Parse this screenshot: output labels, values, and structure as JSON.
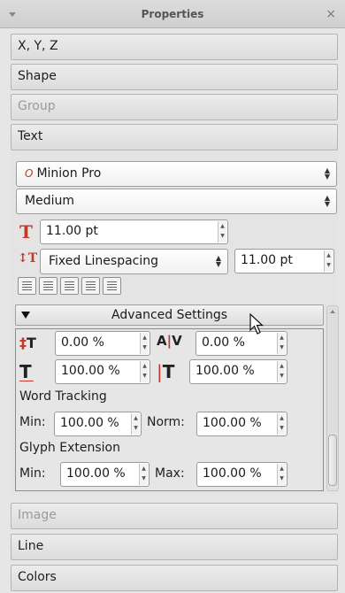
{
  "titlebar": {
    "title": "Properties",
    "close": "×"
  },
  "sections": {
    "xyz": "X, Y, Z",
    "shape": "Shape",
    "group": "Group",
    "text": "Text",
    "image": "Image",
    "line": "Line",
    "colors": "Colors"
  },
  "text_panel": {
    "font_family": "Minion Pro",
    "font_style": "Medium",
    "font_size": "11.00 pt",
    "linespacing_mode": "Fixed Linespacing",
    "linespacing_value": "11.00 pt",
    "alignment_buttons": [
      "align-left",
      "align-center",
      "align-right",
      "align-justify",
      "align-forced-justify"
    ]
  },
  "advanced": {
    "header": "Advanced Settings",
    "baseline_offset": "0.00 %",
    "tracking": "0.00 %",
    "horizontal_scale": "100.00 %",
    "vertical_scale": "100.00 %",
    "word_tracking_label": "Word Tracking",
    "word_min_label": "Min:",
    "word_min": "100.00 %",
    "word_norm_label": "Norm:",
    "word_norm": "100.00 %",
    "glyph_extension_label": "Glyph Extension",
    "glyph_min_label": "Min:",
    "glyph_min": "100.00 %",
    "glyph_max_label": "Max:",
    "glyph_max": "100.00 %"
  },
  "colors": {
    "accent_red": "#c0392b",
    "panel_bg": "#e6e6e6"
  }
}
